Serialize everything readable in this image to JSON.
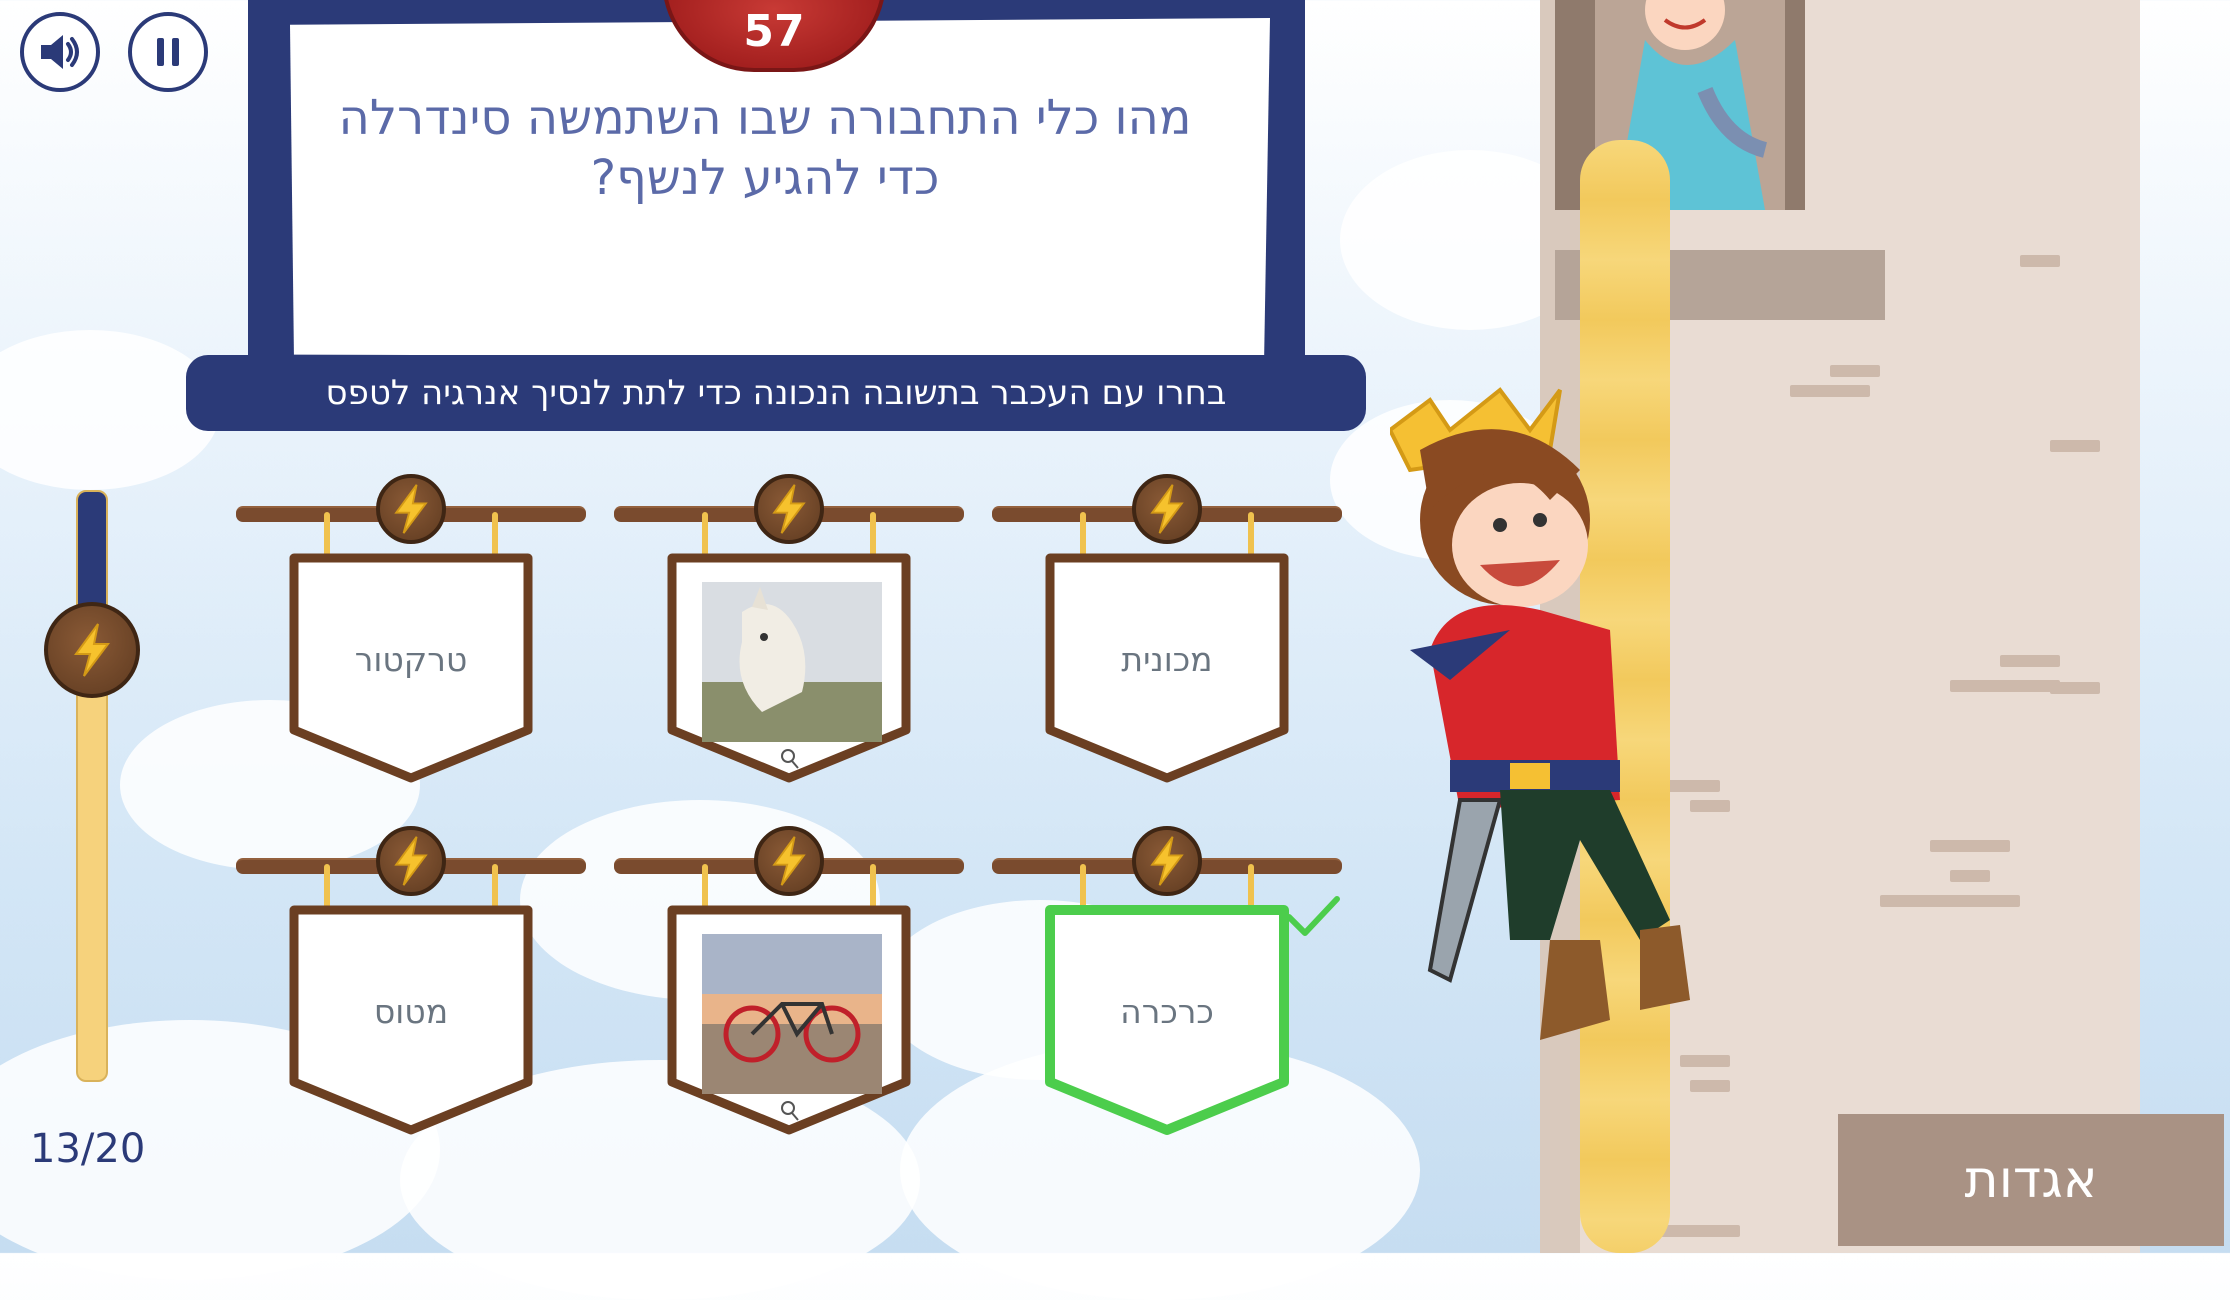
{
  "controls": {
    "sound_icon": "speaker-icon",
    "pause_icon": "pause-icon"
  },
  "question": {
    "timer": "57",
    "text": "מהו כלי התחבורה שבו השתמשה סינדרלה כדי להגיע לנשף?"
  },
  "instruction": "בחרו עם העכבר בתשובה הנכונה כדי לתת לנסיך אנרגיה לטפס",
  "energy": {
    "level": 0.73
  },
  "progress": {
    "counter": "13/20"
  },
  "answers": [
    {
      "id": "tractor",
      "type": "text",
      "label": "טרקטור"
    },
    {
      "id": "horse",
      "type": "image",
      "image": "horse",
      "zoom_icon": "magnifier-icon"
    },
    {
      "id": "car",
      "type": "text",
      "label": "מכונית"
    },
    {
      "id": "plane",
      "type": "text",
      "label": "מטוס"
    },
    {
      "id": "bicycle",
      "type": "image",
      "image": "bicycle",
      "zoom_icon": "magnifier-icon"
    },
    {
      "id": "carriage",
      "type": "text",
      "label": "כרכרה",
      "correct": true
    }
  ],
  "category_button": "אגדות",
  "colors": {
    "navy": "#2b3a78",
    "wood": "#7a4b2e",
    "correct": "#4ccd4c",
    "timer": "#a4201f",
    "energy": "#f6d27c"
  }
}
